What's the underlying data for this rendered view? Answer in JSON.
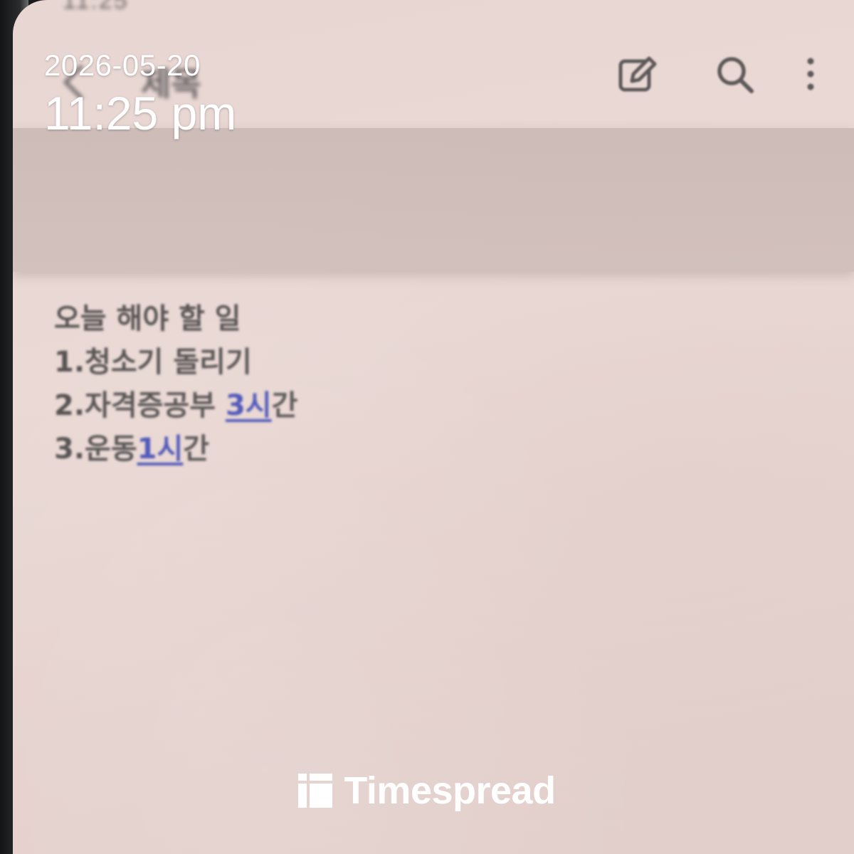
{
  "status_bar": {
    "time": "11:25",
    "right": "",
    "legible": false
  },
  "header": {
    "title": "제목",
    "back_icon": "chevron-left-icon",
    "actions": [
      {
        "name": "edit",
        "icon": "edit-note-icon"
      },
      {
        "name": "search",
        "icon": "search-icon"
      },
      {
        "name": "more",
        "icon": "more-vertical-icon"
      }
    ]
  },
  "note": {
    "heading": "오늘 해야 할 일",
    "items": [
      {
        "prefix": "1.청소기 돌리기",
        "link": "",
        "suffix": ""
      },
      {
        "prefix": "2.자격증공부 ",
        "link": "3시",
        "suffix": "간"
      },
      {
        "prefix": "3.운동",
        "link": "1시",
        "suffix": "간"
      }
    ]
  },
  "stamp": {
    "date": "2026-05-20",
    "time": "11:25 pm"
  },
  "watermark": {
    "brand": "Timespread"
  },
  "colors": {
    "screen_bg": "#e8d6d2",
    "band": "#cdbcb8",
    "text": "#555251",
    "link": "#4b55b8",
    "stamp": "#ffffff"
  }
}
